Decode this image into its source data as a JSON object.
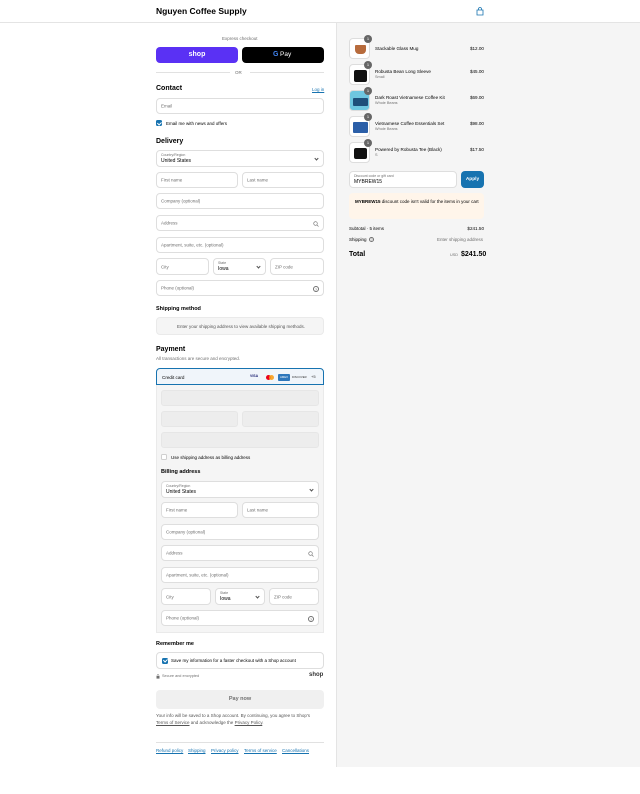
{
  "header": {
    "shop_name": "Nguyen Coffee Supply",
    "cart_icon": "shopping-bag-icon"
  },
  "express": {
    "label": "Express checkout",
    "shop_pay_label": "shop",
    "gpay_label": "Pay",
    "or_label": "OR"
  },
  "contact": {
    "title": "Contact",
    "login_link": "Log in",
    "email_placeholder": "Email",
    "newsletter_label": "Email me with news and offers",
    "newsletter_checked": true
  },
  "delivery": {
    "title": "Delivery",
    "country_label": "Country/Region",
    "country_value": "United States",
    "first_name": "First name",
    "last_name": "Last name",
    "company": "Company (optional)",
    "address": "Address",
    "apartment": "Apartment, suite, etc. (optional)",
    "city": "City",
    "state_label": "State",
    "state_value": "Iowa",
    "zip": "ZIP code",
    "phone": "Phone (optional)"
  },
  "shipping_method": {
    "title": "Shipping method",
    "message": "Enter your shipping address to view available shipping methods."
  },
  "payment": {
    "title": "Payment",
    "subtitle": "All transactions are secure and encrypted.",
    "method_label": "Credit card",
    "card_brands": [
      "VISA",
      "MC",
      "AMEX",
      "DISCOVER"
    ],
    "more_label": "+5",
    "use_shipping_label": "Use shipping address as billing address",
    "use_shipping_checked": false
  },
  "billing": {
    "title": "Billing address",
    "country_label": "Country/Region",
    "country_value": "United States",
    "first_name": "First name",
    "last_name": "Last name",
    "company": "Company (optional)",
    "address": "Address",
    "apartment": "Apartment, suite, etc. (optional)",
    "city": "City",
    "state_label": "State",
    "state_value": "Iowa",
    "zip": "ZIP code",
    "phone": "Phone (optional)"
  },
  "remember": {
    "title": "Remember me",
    "save_label": "Save my information for a faster checkout with a Shop account",
    "save_checked": true,
    "secure_label": "Secure and encrypted",
    "shop_logo": "shop"
  },
  "pay_button": "Pay now",
  "legal": {
    "line1": "Your info will be saved to a Shop account. By continuing, you agree to Shop's",
    "terms": "Terms of Service",
    "middle": "and acknowledge the",
    "privacy": "Privacy Policy",
    "end": "."
  },
  "footer_links": [
    "Refund policy",
    "Shipping",
    "Privacy policy",
    "Terms of service",
    "Cancellations"
  ],
  "order": {
    "items": [
      {
        "name": "Stackable Glass Mug",
        "variant": "",
        "price": "$12.00",
        "qty": "1"
      },
      {
        "name": "Robusta Bean Long Sleeve",
        "variant": "Small",
        "price": "$45.00",
        "qty": "1"
      },
      {
        "name": "Dark Roast Vietnamese Coffee Kit",
        "variant": "Whole Beans",
        "price": "$69.00",
        "qty": "1"
      },
      {
        "name": "Vietnamese Coffee Essentials Set",
        "variant": "Whole Beans",
        "price": "$98.00",
        "qty": "1"
      },
      {
        "name": "Powered by Robusta Tee (Black)",
        "variant": "S",
        "price": "$17.50",
        "qty": "1"
      }
    ],
    "discount_label": "Discount code or gift card",
    "discount_value": "MYBREW15",
    "apply_button": "Apply",
    "discount_error_code": "MYBREW15",
    "discount_error_text": "discount code isn't valid for the items in your cart",
    "subtotal_label": "Subtotal · 5 items",
    "subtotal_value": "$241.50",
    "shipping_label": "Shipping",
    "shipping_value": "Enter shipping address",
    "total_label": "Total",
    "currency": "USD",
    "total_value": "$241.50"
  },
  "colors": {
    "accent": "#1773b0",
    "shop_pay": "#5a31f4",
    "gpay": "#000000",
    "error_bg": "#fff5ea"
  }
}
